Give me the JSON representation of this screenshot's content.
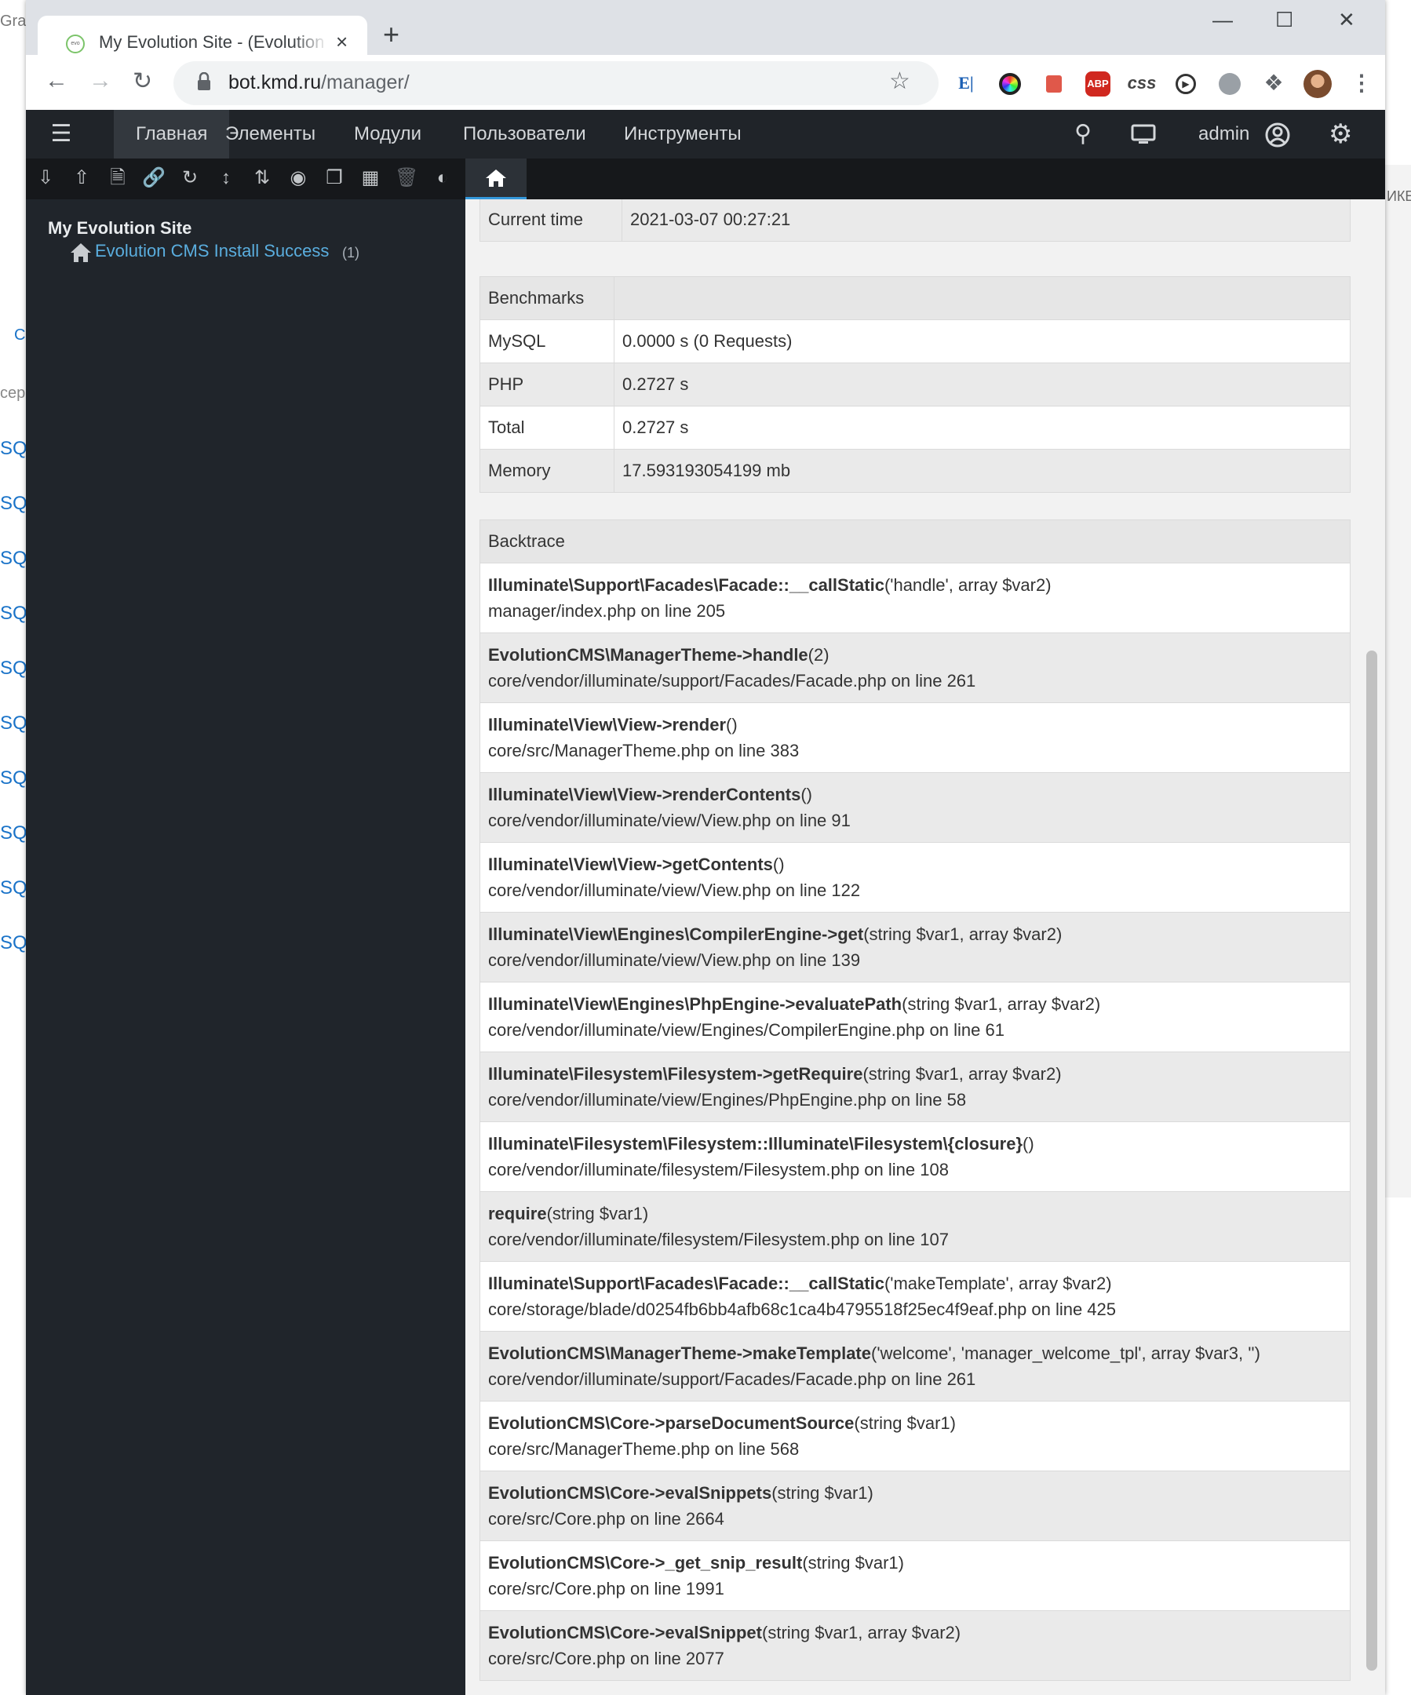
{
  "browser": {
    "tab_title": "My Evolution Site - (Evolution CMS Manager)",
    "tab_close": "×",
    "new_tab": "+",
    "url_host": "bot.kmd.ru",
    "url_path": "/manager/",
    "extensions": [
      "extension-e-icon",
      "color-picker-icon",
      "translate-icon",
      "adblock-icon",
      "css-viewer-icon",
      "video-icon",
      "globe-icon",
      "puzzle-icon",
      "avatar",
      "menu-dots-icon"
    ],
    "adblock_label": "ABP",
    "css_label": "css",
    "window_controls": [
      "minimize-icon",
      "maximize-icon",
      "close-icon"
    ]
  },
  "background_page": {
    "top_text": "Grar",
    "side_texts": [
      "C",
      "сер"
    ],
    "side_links": [
      "SQ",
      "SQ",
      "SQ",
      "SQ",
      "SQ",
      "SQ",
      "SQ",
      "SQ",
      "SQ",
      "SQ"
    ],
    "right_edge_text": "ИКЕ"
  },
  "manager": {
    "nav": {
      "home": "Главная",
      "elements": "Элементы",
      "modules": "Модули",
      "users": "Пользователи",
      "tools": "Инструменты",
      "user_name": "admin"
    },
    "toolbar_icons": [
      "expand-tree-icon",
      "collapse-tree-icon",
      "new-document-icon",
      "new-weblink-icon",
      "refresh-icon",
      "sort-icon",
      "sort-order-icon",
      "camera-icon",
      "copy-icon",
      "grid-icon",
      "trash-icon",
      "contrast-icon"
    ],
    "tree": {
      "site_name": "My Evolution Site",
      "item_label": "Evolution CMS Install Success",
      "item_count": "(1)"
    },
    "current_time": {
      "label": "Current time",
      "value": "2021-03-07 00:27:21"
    },
    "benchmarks": {
      "title": "Benchmarks",
      "rows": [
        {
          "label": "MySQL",
          "value": "0.0000 s (0 Requests)"
        },
        {
          "label": "PHP",
          "value": "0.2727 s"
        },
        {
          "label": "Total",
          "value": "0.2727 s"
        },
        {
          "label": "Memory",
          "value": "17.593193054199 mb"
        }
      ]
    },
    "backtrace": {
      "title": "Backtrace",
      "rows": [
        {
          "fn": "Illuminate\\Support\\Facades\\Facade::__callStatic",
          "args": "('handle', array $var2)",
          "loc": "manager/index.php on line 205"
        },
        {
          "fn": "EvolutionCMS\\ManagerTheme->handle",
          "args": "(2)",
          "loc": "core/vendor/illuminate/support/Facades/Facade.php on line 261"
        },
        {
          "fn": "Illuminate\\View\\View->render",
          "args": "()",
          "loc": "core/src/ManagerTheme.php on line 383"
        },
        {
          "fn": "Illuminate\\View\\View->renderContents",
          "args": "()",
          "loc": "core/vendor/illuminate/view/View.php on line 91"
        },
        {
          "fn": "Illuminate\\View\\View->getContents",
          "args": "()",
          "loc": "core/vendor/illuminate/view/View.php on line 122"
        },
        {
          "fn": "Illuminate\\View\\Engines\\CompilerEngine->get",
          "args": "(string $var1, array $var2)",
          "loc": "core/vendor/illuminate/view/View.php on line 139"
        },
        {
          "fn": "Illuminate\\View\\Engines\\PhpEngine->evaluatePath",
          "args": "(string $var1, array $var2)",
          "loc": "core/vendor/illuminate/view/Engines/CompilerEngine.php on line 61"
        },
        {
          "fn": "Illuminate\\Filesystem\\Filesystem->getRequire",
          "args": "(string $var1, array $var2)",
          "loc": "core/vendor/illuminate/view/Engines/PhpEngine.php on line 58"
        },
        {
          "fn": "Illuminate\\Filesystem\\Filesystem::Illuminate\\Filesystem\\{closure}",
          "args": "()",
          "loc": "core/vendor/illuminate/filesystem/Filesystem.php on line 108"
        },
        {
          "fn": "require",
          "args": "(string $var1)",
          "loc": "core/vendor/illuminate/filesystem/Filesystem.php on line 107"
        },
        {
          "fn": "Illuminate\\Support\\Facades\\Facade::__callStatic",
          "args": "('makeTemplate', array $var2)",
          "loc": "core/storage/blade/d0254fb6bb4afb68c1ca4b4795518f25ec4f9eaf.php on line 425"
        },
        {
          "fn": "EvolutionCMS\\ManagerTheme->makeTemplate",
          "args": "('welcome', 'manager_welcome_tpl', array $var3, '')",
          "loc": "core/vendor/illuminate/support/Facades/Facade.php on line 261"
        },
        {
          "fn": "EvolutionCMS\\Core->parseDocumentSource",
          "args": "(string $var1)",
          "loc": "core/src/ManagerTheme.php on line 568"
        },
        {
          "fn": "EvolutionCMS\\Core->evalSnippets",
          "args": "(string $var1)",
          "loc": "core/src/Core.php on line 2664"
        },
        {
          "fn": "EvolutionCMS\\Core->_get_snip_result",
          "args": "(string $var1)",
          "loc": "core/src/Core.php on line 1991"
        },
        {
          "fn": "EvolutionCMS\\Core->evalSnippet",
          "args": "(string $var1, array $var2)",
          "loc": "core/src/Core.php on line 2077"
        }
      ]
    }
  }
}
